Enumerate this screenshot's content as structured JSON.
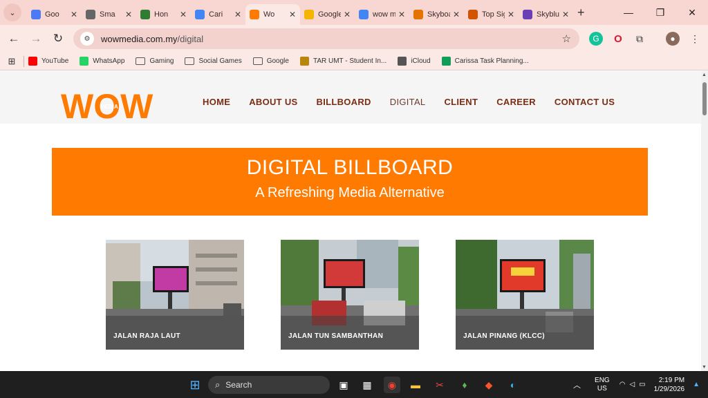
{
  "browser": {
    "tabs": [
      {
        "label": "Goo",
        "icon": "gemini-icon",
        "color": "#4a7bf5"
      },
      {
        "label": "Sma",
        "icon": "openai-icon",
        "color": "#666666"
      },
      {
        "label": "Hon",
        "icon": "ooh-icon",
        "color": "#2e7d32"
      },
      {
        "label": "Cari",
        "icon": "docs-icon",
        "color": "#4285f4"
      },
      {
        "label": "Wo",
        "icon": "wow-icon",
        "color": "#ff7a00"
      },
      {
        "label": "Google",
        "icon": "keep-icon",
        "color": "#f4b400"
      },
      {
        "label": "wow me",
        "icon": "google-icon",
        "color": "#4285f4"
      },
      {
        "label": "Skyboar",
        "icon": "skyboard-icon",
        "color": "#e57300"
      },
      {
        "label": "Top Sign",
        "icon": "topsign-icon",
        "color": "#d35400"
      },
      {
        "label": "Skyblue",
        "icon": "skyblue-icon",
        "color": "#6a3fb5"
      }
    ],
    "url_host": "wowmedia.com.my",
    "url_path": "/digital",
    "bookmarks": [
      {
        "label": "YouTube",
        "icon": "youtube-icon",
        "color": "#ff0000"
      },
      {
        "label": "WhatsApp",
        "icon": "whatsapp-icon",
        "color": "#25d366"
      },
      {
        "label": "Gaming",
        "icon": "folder-icon"
      },
      {
        "label": "Social Games",
        "icon": "folder-icon"
      },
      {
        "label": "Google",
        "icon": "folder-icon"
      },
      {
        "label": "TAR UMT - Student In...",
        "icon": "tarumt-icon",
        "color": "#b8860b"
      },
      {
        "label": "iCloud",
        "icon": "icloud-icon",
        "color": "#555555"
      },
      {
        "label": "Carissa Task Planning...",
        "icon": "sheets-icon",
        "color": "#0f9d58"
      }
    ]
  },
  "site": {
    "logo_text": "WOW",
    "logo_media": "MEDIA",
    "brand_color": "#ff7a00",
    "nav": [
      "HOME",
      "ABOUT US",
      "BILLBOARD",
      "DIGITAL",
      "CLIENT",
      "CAREER",
      "CONTACT US"
    ],
    "hero_title": "DIGITAL BILLBOARD",
    "hero_subtitle": "A Refreshing Media Alternative",
    "locations": [
      "JALAN RAJA LAUT",
      "JALAN TUN SAMBANTHAN",
      "JALAN PINANG (KLCC)"
    ]
  },
  "taskbar": {
    "search_placeholder": "Search",
    "lang_top": "ENG",
    "lang_bottom": "US",
    "time": "2:19 PM",
    "date": "1/29/2026"
  }
}
